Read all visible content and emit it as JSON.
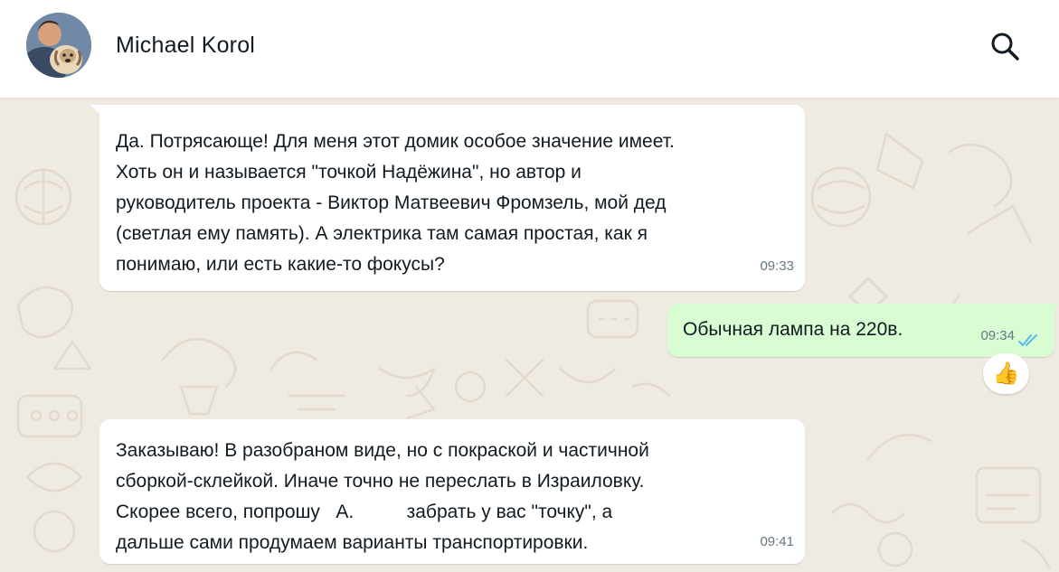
{
  "header": {
    "contact_name": "Michael Korol",
    "avatar_icon": "contact-avatar-photo",
    "search_icon": "search-icon"
  },
  "messages": [
    {
      "direction": "incoming",
      "text": "Да. Потрясающе! Для меня этот домик особое значение имеет.\nХоть он и называется \"точкой Надёжина\", но автор и\nруководитель проекта - Виктор Матвеевич Фромзель, мой дед\n(светлая ему память). А электрика там самая простая, как я\nпонимаю, или есть какие-то фокусы?",
      "time": "09:33"
    },
    {
      "direction": "outgoing",
      "text": "Обычная лампа на 220в.",
      "time": "09:34",
      "status_icon": "double-check-read-icon",
      "reaction": "👍"
    },
    {
      "direction": "incoming",
      "text": "Заказываю! В разобраном виде, но с покраской и частичной\nсборкой-склейкой. Иначе точно не переслать в Израиловку.\nСкорее всего, попрошу   А.          забрать у вас \"точку\", а\nдальше сами продумаем варианты транспортировки.",
      "time": "09:41"
    }
  ],
  "colors": {
    "chat_background": "#efeae2",
    "incoming_bubble": "#ffffff",
    "outgoing_bubble": "#d9fdd3",
    "read_ticks": "#53bdeb",
    "timestamp": "#667781"
  }
}
